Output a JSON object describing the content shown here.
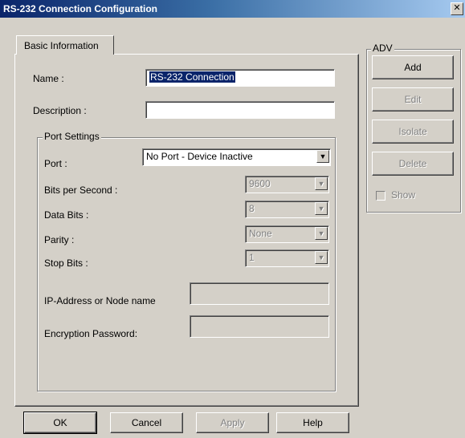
{
  "window": {
    "title": "RS-232 Connection Configuration",
    "close_glyph": "✕"
  },
  "tab": {
    "label": "Basic Information"
  },
  "fields": {
    "name_label": "Name :",
    "name_value": "RS-232 Connection",
    "description_label": "Description :",
    "description_value": ""
  },
  "port_settings": {
    "title": "Port Settings",
    "port_label": "Port :",
    "port_value": "No Port - Device Inactive",
    "bps_label": "Bits per Second :",
    "bps_value": "9600",
    "data_bits_label": "Data Bits :",
    "data_bits_value": "8",
    "parity_label": "Parity :",
    "parity_value": "None",
    "stop_bits_label": "Stop Bits :",
    "stop_bits_value": "1",
    "ip_label": "IP-Address or Node name",
    "ip_value": "",
    "encryption_label": "Encryption Password:",
    "encryption_value": ""
  },
  "adv": {
    "title": "ADV",
    "add": "Add",
    "edit": "Edit",
    "isolate": "Isolate",
    "delete": "Delete",
    "show": "Show"
  },
  "footer": {
    "ok": "OK",
    "cancel": "Cancel",
    "apply": "Apply",
    "help": "Help"
  },
  "icons": {
    "dropdown_arrow": "▼"
  }
}
